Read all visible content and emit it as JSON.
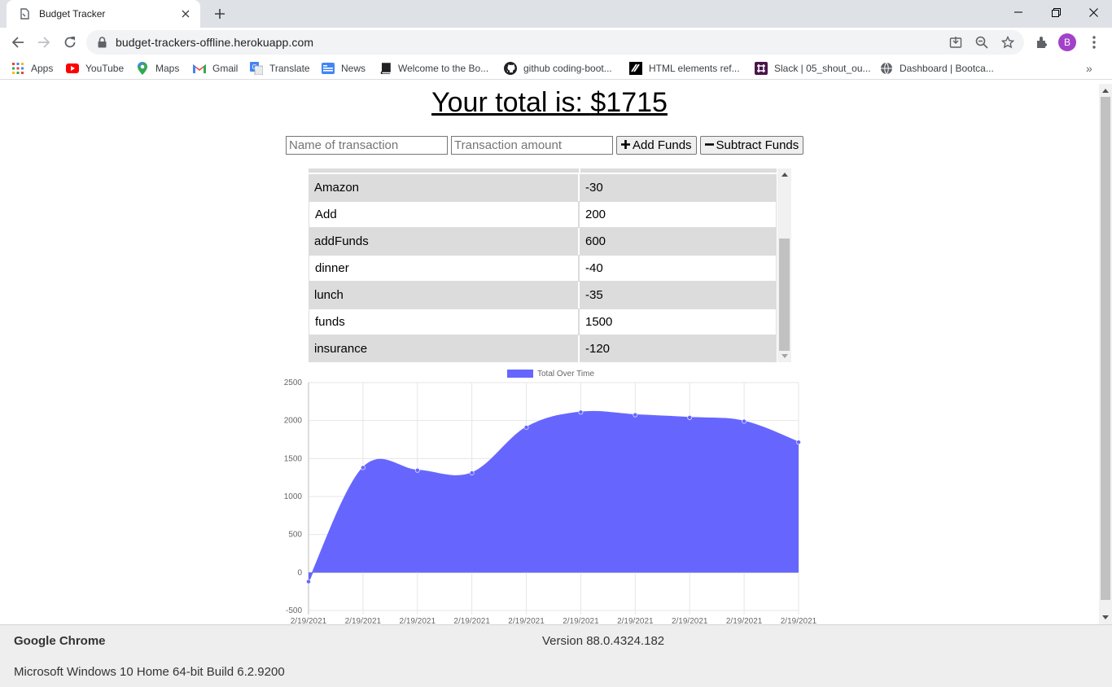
{
  "browser": {
    "tab_title": "Budget Tracker",
    "url": "budget-trackers-offline.herokuapp.com",
    "profile_initial": "B",
    "bookmarks": [
      {
        "label": "Apps",
        "icon": "apps-grid-icon"
      },
      {
        "label": "YouTube",
        "icon": "youtube-icon"
      },
      {
        "label": "Maps",
        "icon": "maps-pin-icon"
      },
      {
        "label": "Gmail",
        "icon": "gmail-icon"
      },
      {
        "label": "Translate",
        "icon": "translate-icon"
      },
      {
        "label": "News",
        "icon": "news-icon"
      },
      {
        "label": "Welcome to the Bo...",
        "icon": "book-icon"
      },
      {
        "label": "github coding-boot...",
        "icon": "github-icon"
      },
      {
        "label": "HTML elements ref...",
        "icon": "mdn-icon"
      },
      {
        "label": "Slack | 05_shout_ou...",
        "icon": "slack-icon"
      },
      {
        "label": "Dashboard | Bootca...",
        "icon": "globe-icon"
      }
    ],
    "bookmarks_more": "»"
  },
  "app": {
    "total_label": "Your total is: ",
    "total_value": "$1715",
    "name_placeholder": "Name of transaction",
    "amount_placeholder": "Transaction amount",
    "add_label": "Add Funds",
    "subtract_label": "Subtract Funds",
    "transactions": [
      {
        "name": "Amazon",
        "value": "-30"
      },
      {
        "name": "Add",
        "value": "200"
      },
      {
        "name": "addFunds",
        "value": "600"
      },
      {
        "name": "dinner",
        "value": "-40"
      },
      {
        "name": "lunch",
        "value": "-35"
      },
      {
        "name": "funds",
        "value": "1500"
      },
      {
        "name": "insurance",
        "value": "-120"
      }
    ]
  },
  "chart_data": {
    "type": "area",
    "legend": "Total Over Time",
    "legend_position": "top",
    "color": "#6666ff",
    "x": [
      "2/19/2021",
      "2/19/2021",
      "2/19/2021",
      "2/19/2021",
      "2/19/2021",
      "2/19/2021",
      "2/19/2021",
      "2/19/2021",
      "2/19/2021",
      "2/19/2021"
    ],
    "values": [
      -120,
      1380,
      1345,
      1310,
      1910,
      2110,
      2075,
      2040,
      1990,
      1715
    ],
    "ylim": [
      -500,
      2500
    ],
    "yticks": [
      2500,
      2000,
      1500,
      1000,
      500,
      0,
      -500
    ],
    "grid": true
  },
  "about": {
    "product": "Google Chrome",
    "version": "Version 88.0.4324.182",
    "os": "Microsoft Windows 10 Home 64-bit Build 6.2.9200"
  }
}
